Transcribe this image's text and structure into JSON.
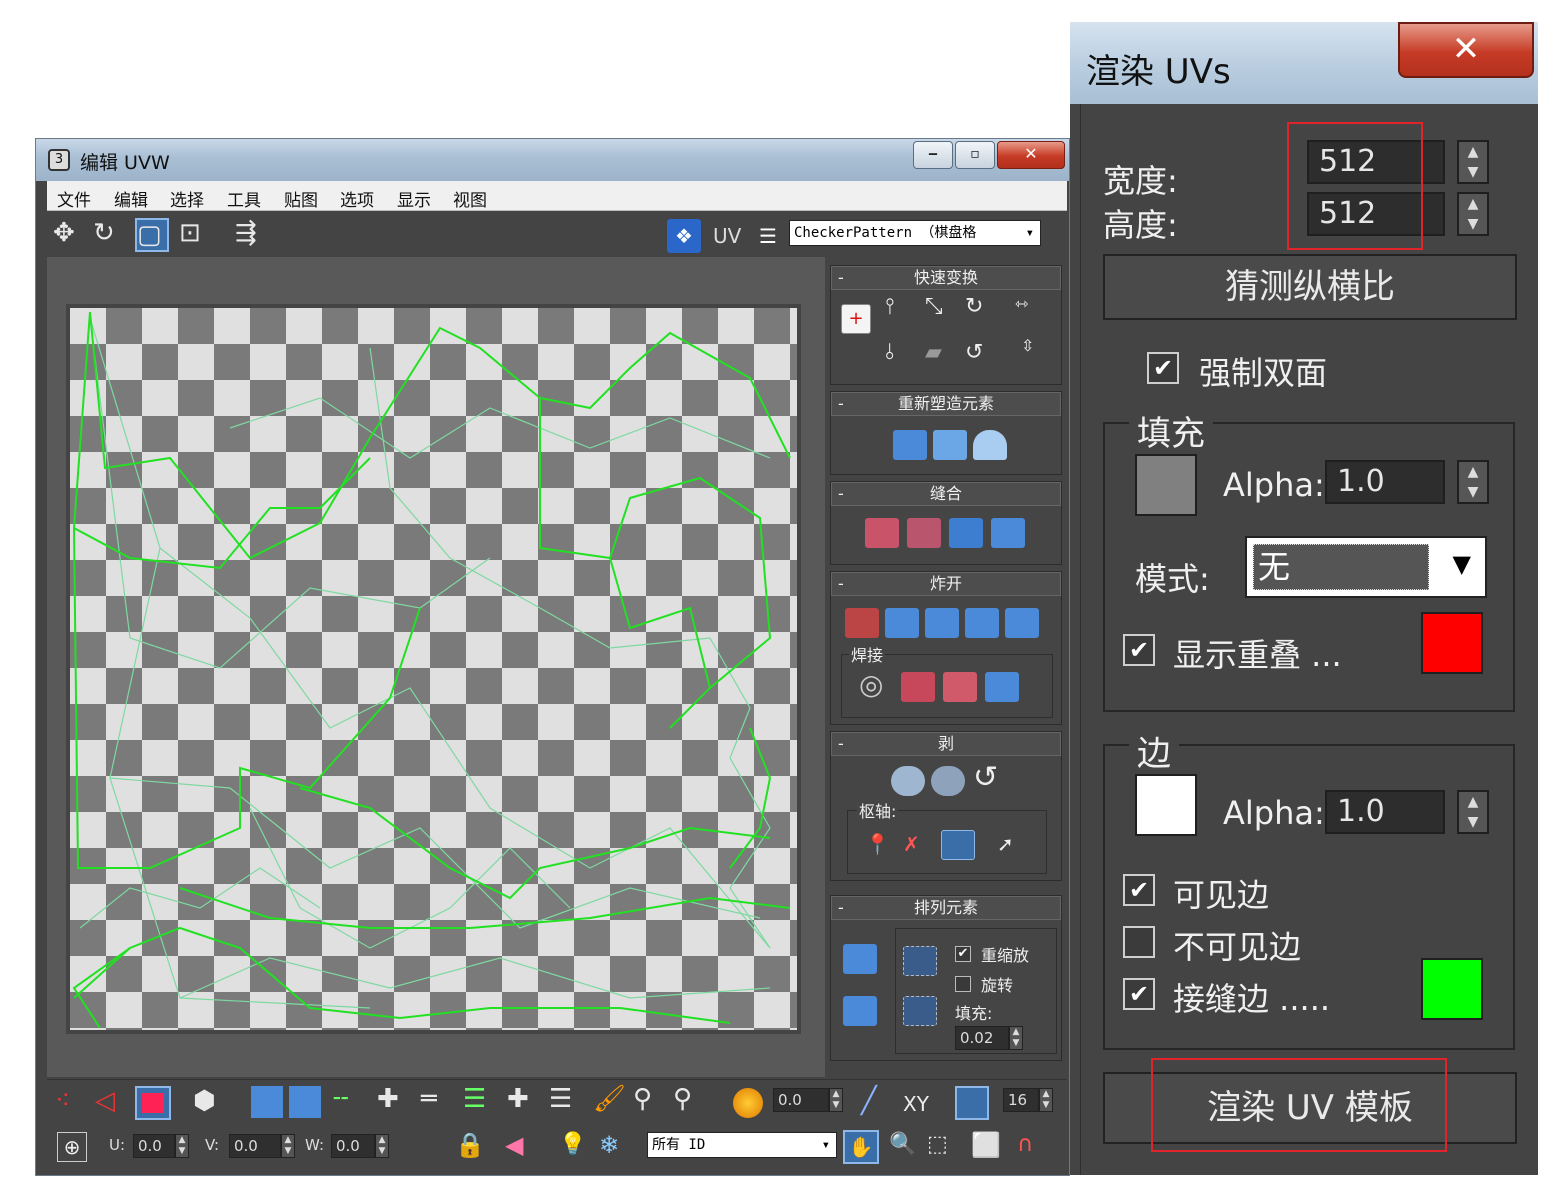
{
  "uvw": {
    "title": "编辑 UVW",
    "app_icon": "3",
    "menu": [
      "文件",
      "编辑",
      "选择",
      "工具",
      "贴图",
      "选项",
      "显示",
      "视图"
    ],
    "uv_label": "UV",
    "texture_dropdown": "CheckerPattern （棋盘格",
    "rollouts": {
      "quick_transform": "快速变换",
      "reshape": "重新塑造元素",
      "stitch": "缝合",
      "explode": "炸开",
      "weld": "焊接",
      "peel": "剥",
      "pivot": "枢轴:",
      "arrange": "排列元素",
      "rescale": "重缩放",
      "rotate": "旋转",
      "padding_label": "填充:",
      "padding_value": "0.02",
      "rescale_checked": true,
      "rotate_checked": false
    },
    "bottom": {
      "soft_select_value": "0.0",
      "xy_label": "XY",
      "grid_value": "16",
      "u_label": "U:",
      "u_value": "0.0",
      "v_label": "V:",
      "v_value": "0.0",
      "w_label": "W:",
      "w_value": "0.0",
      "id_dropdown": "所有 ID"
    },
    "colors": {
      "wire_bright": "#22e022",
      "wire_pale": "#7ed9a0"
    }
  },
  "render": {
    "title": "渲染 UVs",
    "width_label": "宽度:",
    "width_value": "512",
    "height_label": "高度:",
    "height_value": "512",
    "guess_aspect_button": "猜测纵横比",
    "force_two_sided": "强制双面",
    "force_two_sided_checked": true,
    "fill": {
      "group_label": "填充",
      "alpha_label": "Alpha:",
      "alpha_value": "1.0",
      "mode_label": "模式:",
      "mode_value": "无",
      "show_overlap": "显示重叠 ...",
      "show_overlap_checked": true,
      "fill_color": "#808080",
      "overlap_color": "#ff0000"
    },
    "edges": {
      "group_label": "边",
      "alpha_label": "Alpha:",
      "alpha_value": "1.0",
      "visible_edges": "可见边",
      "visible_edges_checked": true,
      "invisible_edges": "不可见边",
      "invisible_edges_checked": false,
      "seam_edges": "接缝边 .....",
      "seam_edges_checked": true,
      "edge_color": "#ffffff",
      "seam_color": "#00ff00"
    },
    "render_button": "渲染 UV 模板",
    "highlight_color": "#e0242a"
  }
}
